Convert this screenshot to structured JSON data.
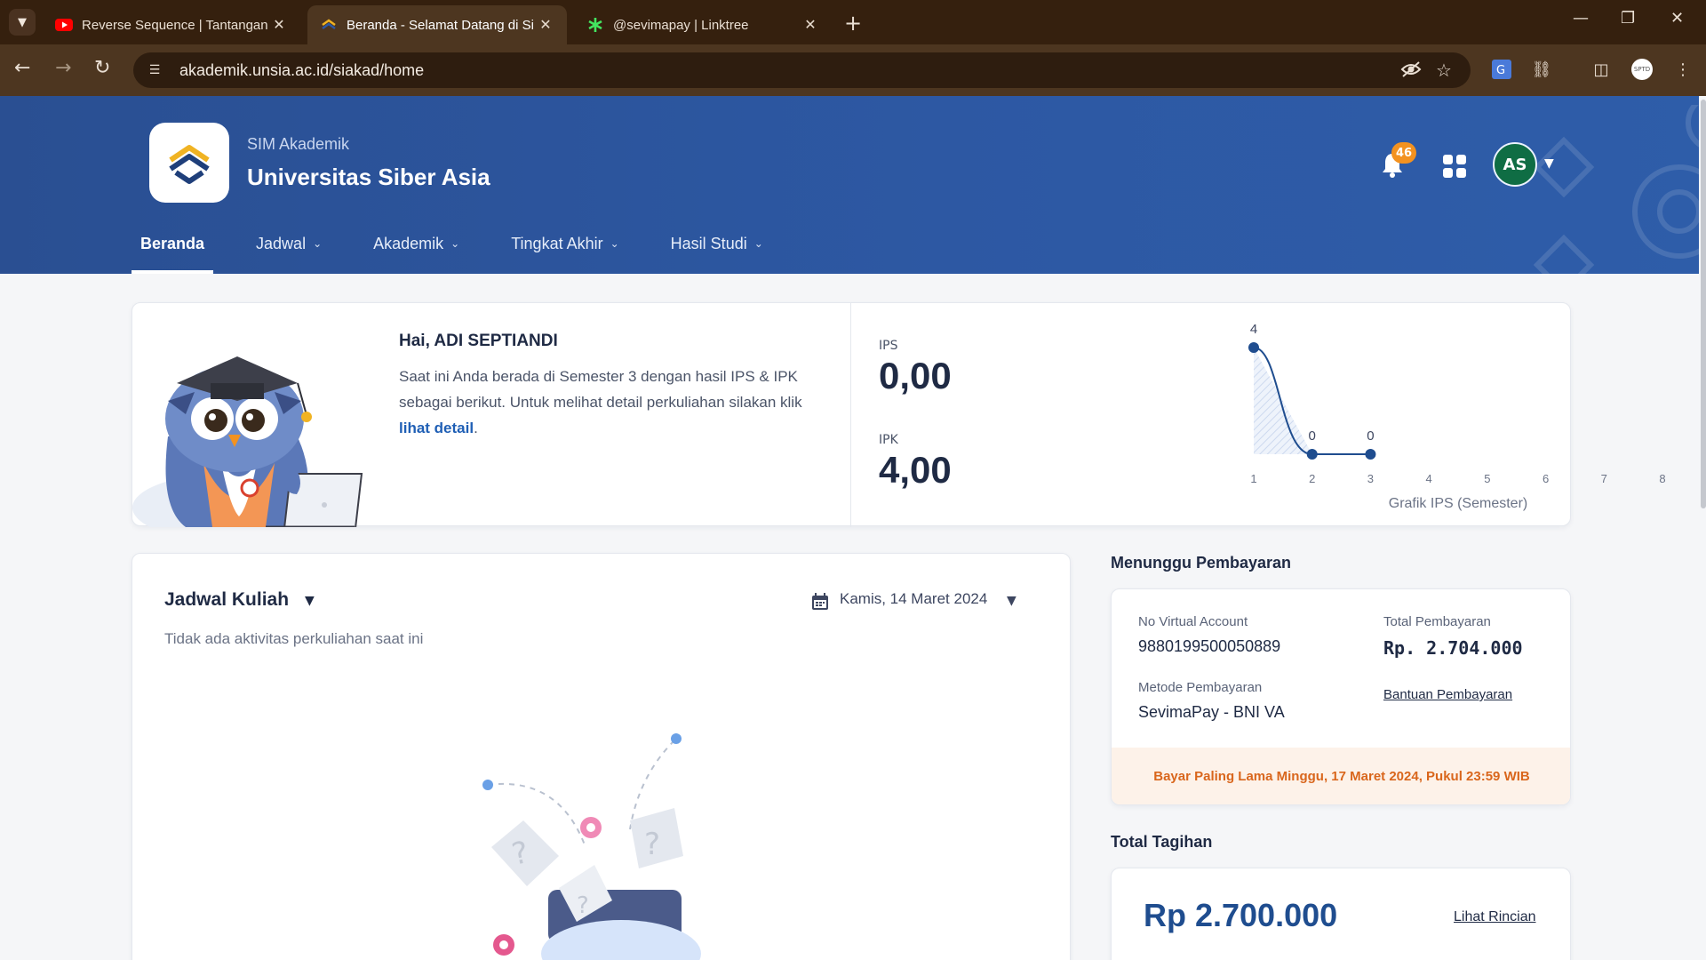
{
  "browser": {
    "tabs": [
      {
        "title": "Reverse Sequence | Tantangan C",
        "icon": "youtube-icon",
        "active": false
      },
      {
        "title": "Beranda - Selamat Datang di Si",
        "icon": "unsia-icon",
        "active": true
      },
      {
        "title": "@sevimapay | Linktree",
        "icon": "linktree-icon",
        "active": false
      }
    ],
    "url": "akademik.unsia.ac.id/siakad/home",
    "profile_label": "SPTD"
  },
  "header": {
    "subtitle": "SIM Akademik",
    "title": "Universitas Siber Asia",
    "notification_count": "46",
    "avatar_initials": "AS",
    "brand_color": "#2d58a3"
  },
  "nav": {
    "items": [
      {
        "label": "Beranda",
        "active": true,
        "has_dropdown": false
      },
      {
        "label": "Jadwal",
        "active": false,
        "has_dropdown": true
      },
      {
        "label": "Akademik",
        "active": false,
        "has_dropdown": true
      },
      {
        "label": "Tingkat Akhir",
        "active": false,
        "has_dropdown": true
      },
      {
        "label": "Hasil Studi",
        "active": false,
        "has_dropdown": true
      }
    ]
  },
  "summary": {
    "greeting": "Hai, ADI SEPTIANDI",
    "description": "Saat ini Anda berada di Semester 3 dengan hasil IPS & IPK sebagai berikut. Untuk melihat detail perkuliahan silakan klik ",
    "detail_link": "lihat detail",
    "description_end": ".",
    "ips_label": "IPS",
    "ips_value": "0,00",
    "ipk_label": "IPK",
    "ipk_value": "4,00"
  },
  "chart_data": {
    "type": "line",
    "x": [
      1,
      2,
      3,
      4,
      5,
      6,
      7,
      8
    ],
    "series": [
      {
        "values": [
          4,
          0,
          0
        ],
        "color": "#1f4d8f"
      }
    ],
    "data_labels": [
      "4",
      "0",
      "0"
    ],
    "xlabel": "Grafik IPS (Semester)",
    "ylabel": "",
    "xlim": [
      1,
      8
    ],
    "ylim": [
      0,
      4
    ],
    "grid": false,
    "area_fill": true
  },
  "schedule": {
    "title": "Jadwal Kuliah",
    "date": "Kamis, 14 Maret 2024",
    "empty_message": "Tidak ada aktivitas perkuliahan saat ini"
  },
  "payment": {
    "section_title": "Menunggu Pembayaran",
    "va_label": "No Virtual Account",
    "va_value": "9880199500050889",
    "total_label": "Total Pembayaran",
    "total_value": "Rp. 2.704.000",
    "method_label": "Metode Pembayaran",
    "method_value": "SevimaPay - BNI VA",
    "help_link": "Bantuan Pembayaran",
    "deadline": "Bayar Paling Lama Minggu, 17 Maret 2024, Pukul 23:59 WIB"
  },
  "tagihan": {
    "section_title": "Total Tagihan",
    "amount": "Rp 2.700.000",
    "detail_link": "Lihat Rincian"
  }
}
